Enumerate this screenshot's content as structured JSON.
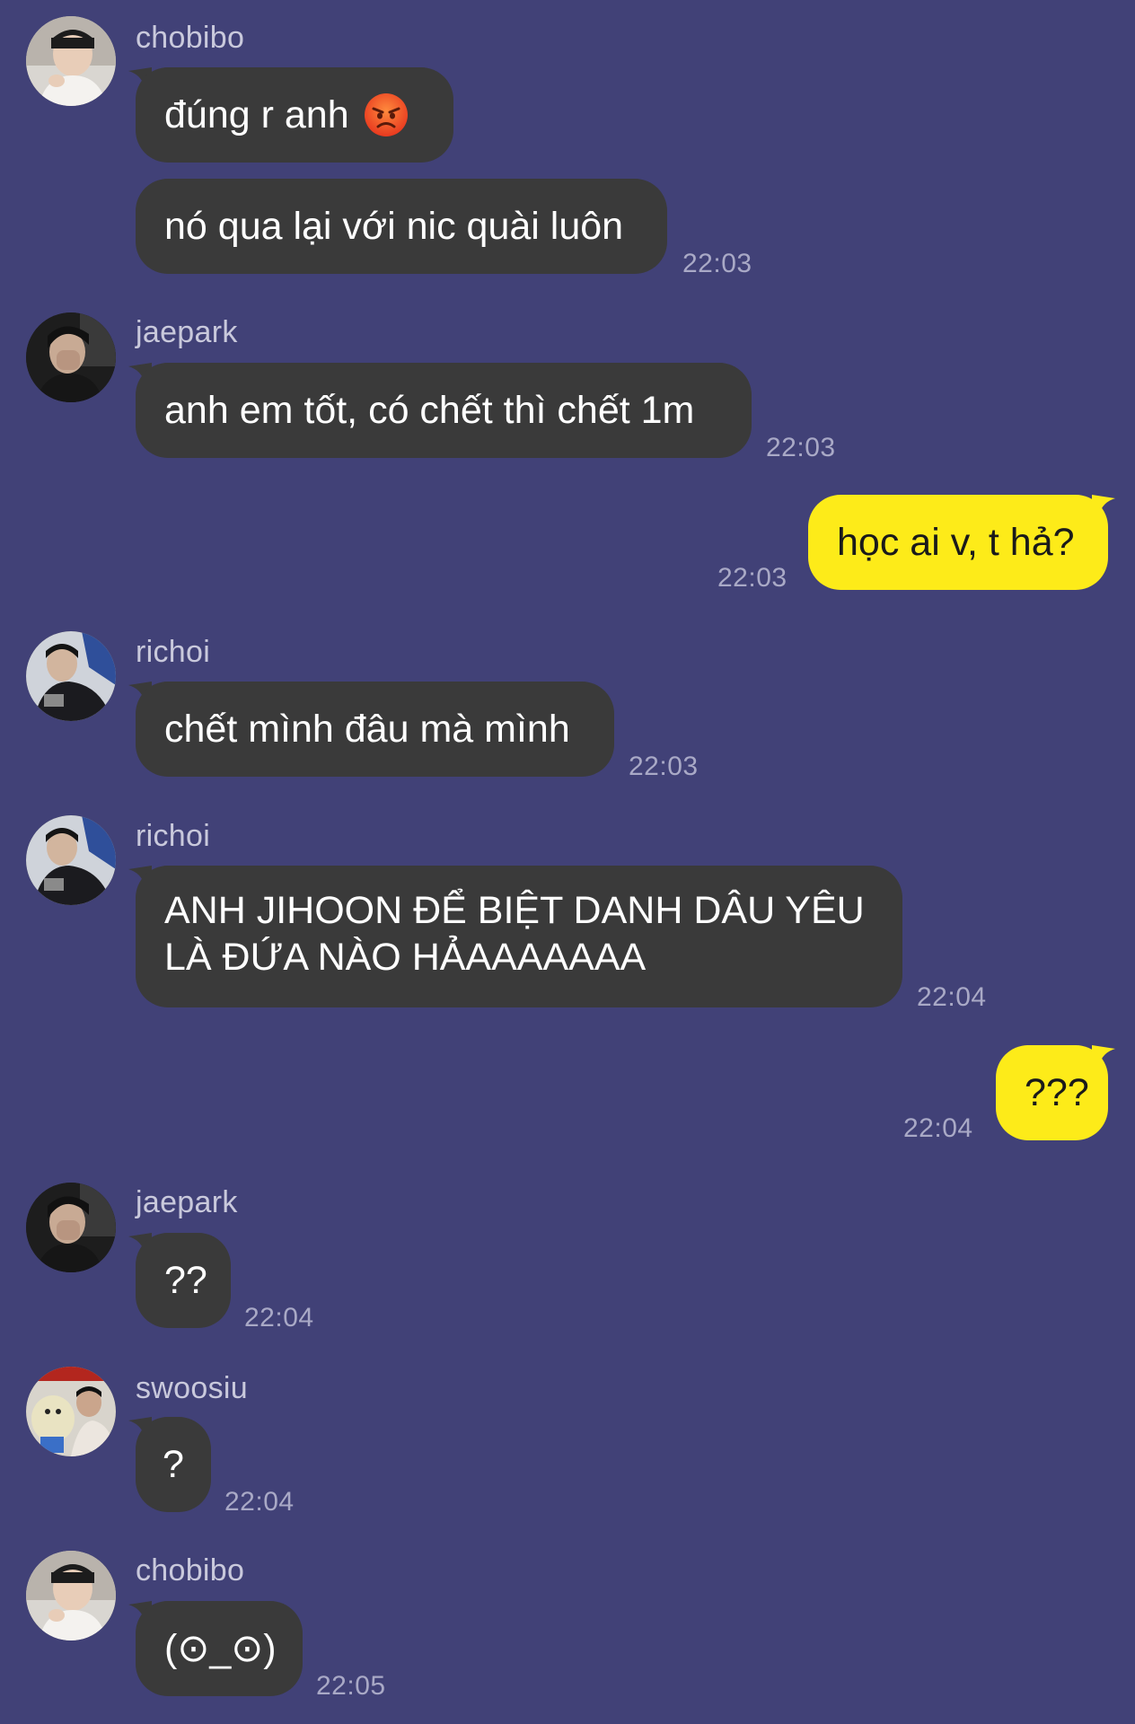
{
  "colors": {
    "background": "#414177",
    "incoming_bubble": "#3a3a3a",
    "outgoing_bubble": "#fdeb19",
    "timestamp": "#a9a9c6",
    "sender_name": "#c9c9dc"
  },
  "messages": [
    {
      "sender": "chobibo",
      "text": "đúng r anh",
      "emoji": "angry-face-icon"
    },
    {
      "sender": "chobibo",
      "text": "nó qua lại với nic quài luôn",
      "time": "22:03"
    },
    {
      "sender": "jaepark",
      "text": "anh em tốt, có chết thì chết 1m",
      "time": "22:03"
    },
    {
      "sender": "me",
      "text": "học ai v, t hả?",
      "time": "22:03"
    },
    {
      "sender": "richoi",
      "text": "chết mình đâu mà mình",
      "time": "22:03"
    },
    {
      "sender": "richoi",
      "text_lines": [
        "ANH JIHOON ĐỂ BIỆT DANH DÂU YÊU",
        "LÀ ĐỨA NÀO HẢAAAAAAA"
      ],
      "time": "22:04"
    },
    {
      "sender": "me",
      "text": "???",
      "time": "22:04"
    },
    {
      "sender": "jaepark",
      "text": "??",
      "time": "22:04"
    },
    {
      "sender": "swoosiu",
      "text": "?",
      "time": "22:04"
    },
    {
      "sender": "chobibo",
      "text": "(⊙_⊙)",
      "time": "22:05"
    }
  ]
}
